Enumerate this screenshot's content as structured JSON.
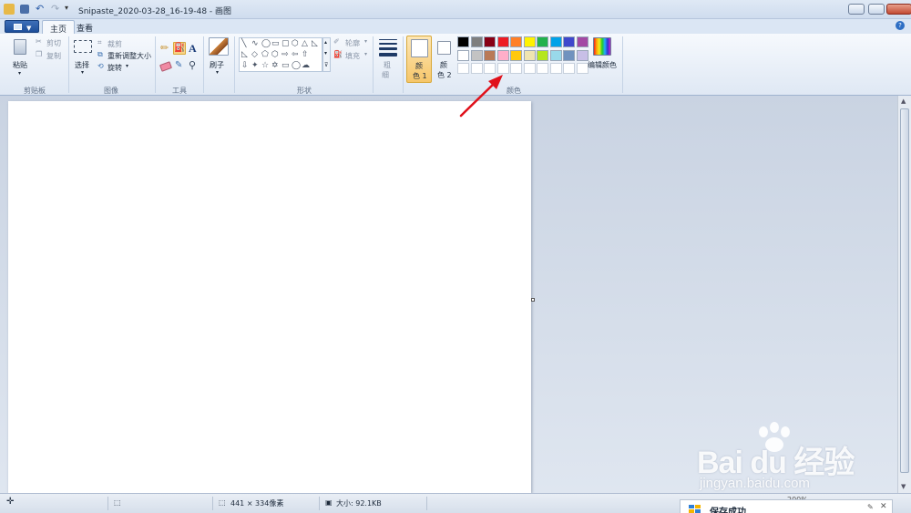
{
  "window": {
    "title": "Snipaste_2020-03-28_16-19-48 - 画图"
  },
  "tabs": [
    {
      "label": "主页",
      "active": true
    },
    {
      "label": "查看",
      "active": false
    }
  ],
  "ribbon": {
    "clipboard": {
      "group_label": "剪贴板",
      "paste_label": "粘贴",
      "cut_label": "剪切",
      "copy_label": "复制"
    },
    "image": {
      "group_label": "图像",
      "select_label": "选择",
      "crop_label": "裁剪",
      "resize_label": "重新调整大小",
      "rotate_label": "旋转"
    },
    "tools": {
      "group_label": "工具",
      "items": [
        "pencil-icon",
        "fill-icon",
        "text-icon",
        "eraser-icon",
        "color-picker-icon",
        "magnifier-icon"
      ]
    },
    "brushes": {
      "label": "刷子"
    },
    "shapes": {
      "group_label": "形状",
      "outline_label": "轮廓",
      "fill_label": "填充"
    },
    "size": {
      "label_line1": "粗",
      "label_line2": "细"
    },
    "colors": {
      "group_label": "颜色",
      "color1_line1": "颜",
      "color1_line2": "色 1",
      "color2_line1": "颜",
      "color2_line2": "色 2",
      "edit_colors_label": "编辑颜色",
      "row1": [
        "#000000",
        "#7f7f7f",
        "#880015",
        "#ed1c24",
        "#ff7f27",
        "#fff200",
        "#22b14c",
        "#00a2e8",
        "#3f48cc",
        "#a349a4"
      ],
      "row2": [
        "#ffffff",
        "#c3c3c3",
        "#b97a57",
        "#ffaec9",
        "#ffc90e",
        "#efe4b0",
        "#b5e61d",
        "#99d9ea",
        "#7092be",
        "#c8bfe7"
      ]
    }
  },
  "statusbar": {
    "dimensions": "441 × 334像素",
    "file_size": "大小: 92.1KB",
    "zoom": "200%"
  },
  "notification": {
    "text": "保存成功"
  },
  "watermark": {
    "brand": "Bai du 经验",
    "url": "jingyan.baidu.com"
  },
  "colors": {
    "accent": "#2f6fc4",
    "annotation_arrow": "#e0101a",
    "selected_button": "#f9d488"
  }
}
